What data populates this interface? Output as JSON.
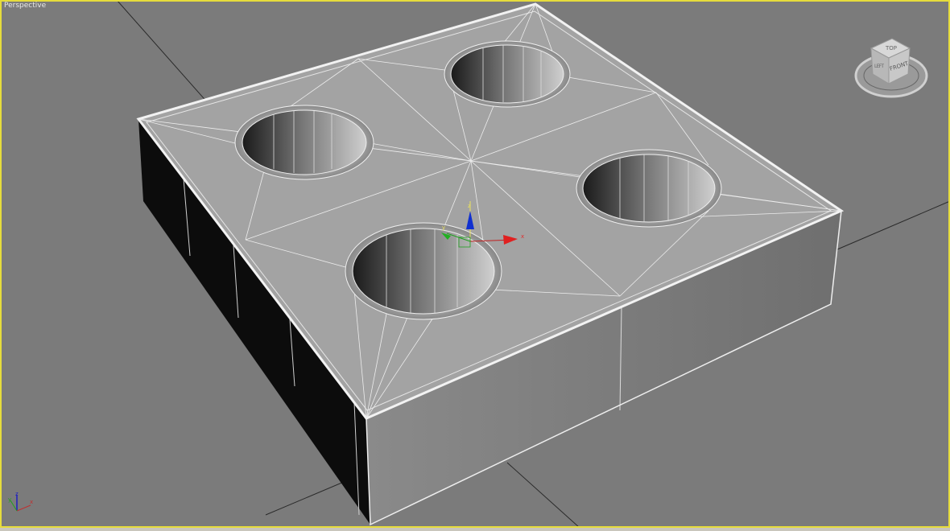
{
  "viewport": {
    "label": "Perspective",
    "active_border_color": "#e6dc3c",
    "background_color": "#7b7b7b"
  },
  "viewcube": {
    "top": "TOP",
    "front": "FRONT",
    "left": "LEFT"
  },
  "gizmo": {
    "x": "x",
    "y": "y",
    "z": "z"
  },
  "axis_tripod": {
    "x": "x",
    "y": "y",
    "z": "z"
  }
}
